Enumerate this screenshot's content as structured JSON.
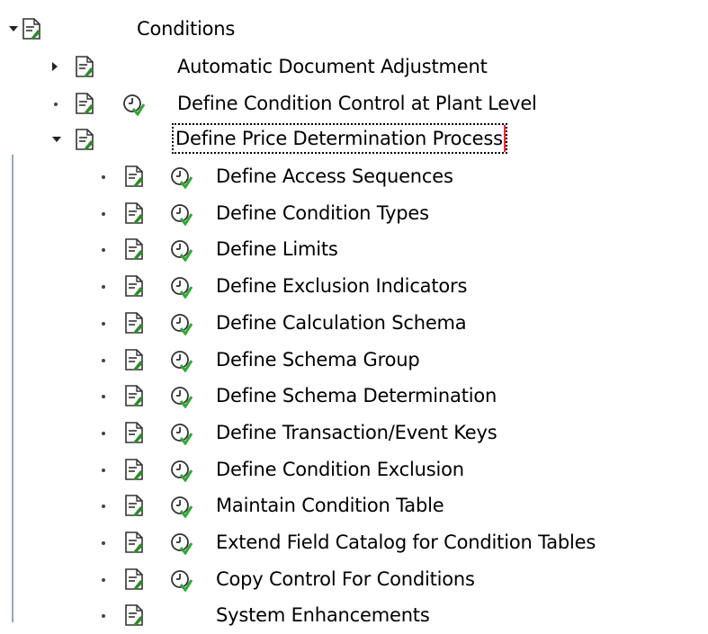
{
  "colors": {
    "doc_icon_green": "#2f8a2b",
    "doc_icon_stroke": "#333333",
    "clock_green": "#32a736",
    "tree_line": "#9aa7bb",
    "selection_border": "#e0313b"
  },
  "tree": {
    "root": {
      "label": "Conditions",
      "toggle": "expanded",
      "icon": "document-icon"
    },
    "level1": [
      {
        "label": "Automatic Document Adjustment",
        "toggle": "collapsed",
        "icon": "document-icon",
        "activity_icon": false
      },
      {
        "label": "Define Condition Control at Plant Level",
        "toggle": "leaf",
        "icon": "document-icon",
        "activity_icon": true
      },
      {
        "label": "Define Price Determination Process",
        "toggle": "expanded",
        "icon": "document-icon",
        "activity_icon": false,
        "selected": true
      }
    ],
    "level2": [
      {
        "label": "Define Access Sequences",
        "activity_icon": true
      },
      {
        "label": "Define Condition Types",
        "activity_icon": true
      },
      {
        "label": "Define Limits",
        "activity_icon": true
      },
      {
        "label": "Define Exclusion Indicators",
        "activity_icon": true
      },
      {
        "label": "Define Calculation Schema",
        "activity_icon": true
      },
      {
        "label": "Define Schema Group",
        "activity_icon": true
      },
      {
        "label": "Define Schema Determination",
        "activity_icon": true
      },
      {
        "label": "Define Transaction/Event Keys",
        "activity_icon": true
      },
      {
        "label": "Define Condition Exclusion",
        "activity_icon": true
      },
      {
        "label": "Maintain Condition Table",
        "activity_icon": true
      },
      {
        "label": "Extend Field Catalog for Condition Tables",
        "activity_icon": true
      },
      {
        "label": "Copy Control For Conditions",
        "activity_icon": true
      },
      {
        "label": "System Enhancements",
        "activity_icon": false
      }
    ]
  }
}
